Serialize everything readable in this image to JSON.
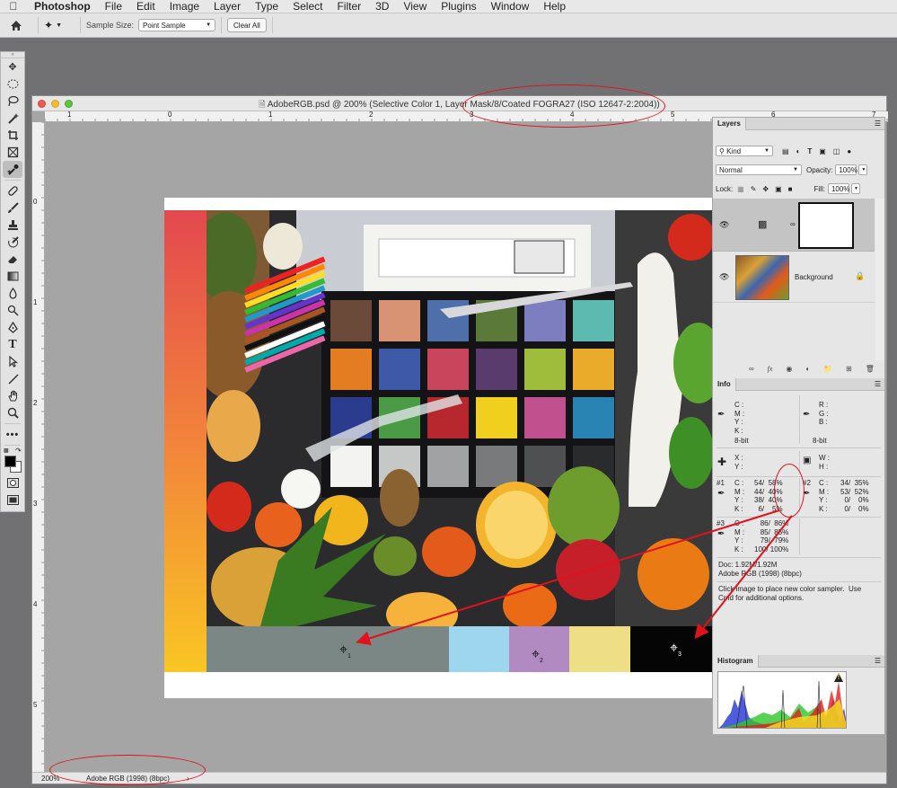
{
  "menubar": {
    "apple": "",
    "app": "Photoshop",
    "items": [
      "File",
      "Edit",
      "Image",
      "Layer",
      "Type",
      "Select",
      "Filter",
      "3D",
      "View",
      "Plugins",
      "Window",
      "Help"
    ]
  },
  "options": {
    "sample_size_label": "Sample Size:",
    "sample_size_value": "Point Sample",
    "clear_all": "Clear All"
  },
  "document": {
    "title": "AdobeRGB.psd @ 200% (Selective Color 1, Layer Mask/8/Coated FOGRA27 (ISO 12647-2:2004))",
    "ruler_h": [
      "1",
      "0",
      "1",
      "2",
      "3",
      "4",
      "5",
      "6",
      "7"
    ],
    "ruler_v": [
      "0",
      "1",
      "2",
      "3",
      "4",
      "5"
    ],
    "status_zoom": "200%",
    "status_profile": "Adobe RGB (1998) (8bpc)",
    "sampler_labels": [
      "1",
      "2",
      "3"
    ]
  },
  "layers": {
    "tab": "Layers",
    "kind_label": "Kind",
    "blend_mode": "Normal",
    "opacity_label": "Opacity:",
    "opacity_value": "100%",
    "lock_label": "Lock:",
    "fill_label": "Fill:",
    "fill_value": "100%",
    "items": [
      {
        "name": ""
      },
      {
        "name": "Background"
      }
    ]
  },
  "info": {
    "tab": "Info",
    "cmyk_labels": "C :\nM :\nY :\nK :",
    "rgb_labels": "R :\nG :\nB :",
    "bit_left": "8-bit",
    "bit_right": "8-bit",
    "xy_labels": "X :\nY :",
    "wh_labels": "W :\nH :",
    "s1_id": "#1",
    "s1_labels": "C :\nM :\nY :\nK :",
    "s1_values": "54/  58%\n44/  40%\n38/  40%\n6/    5%",
    "s2_id": "#2",
    "s2_labels": "C :\nM :\nY :\nK :",
    "s2_values": "34/  35%\n53/  52%\n0/    0%\n0/    0%",
    "s3_id": "#3",
    "s3_labels": "C :\nM :\nY :\nK :",
    "s3_values": "86/  86%\n85/  85%\n79/  79%\n100/ 100%",
    "doc_size": "Doc: 1.92M/1.92M",
    "doc_profile": "Adobe RGB (1998) (8bpc)",
    "hint": "Click image to place new color sampler.  Use\nCmd for additional options."
  },
  "histogram": {
    "tab": "Histogram",
    "warning": "!"
  },
  "colors": {
    "annotation": "#e0121b",
    "swatch_gray": "#7a8784",
    "swatch_lightblue": "#9dd6ee",
    "swatch_purple": "#b08ac0",
    "swatch_yellow": "#eedf86",
    "swatch_black": "#050505"
  }
}
